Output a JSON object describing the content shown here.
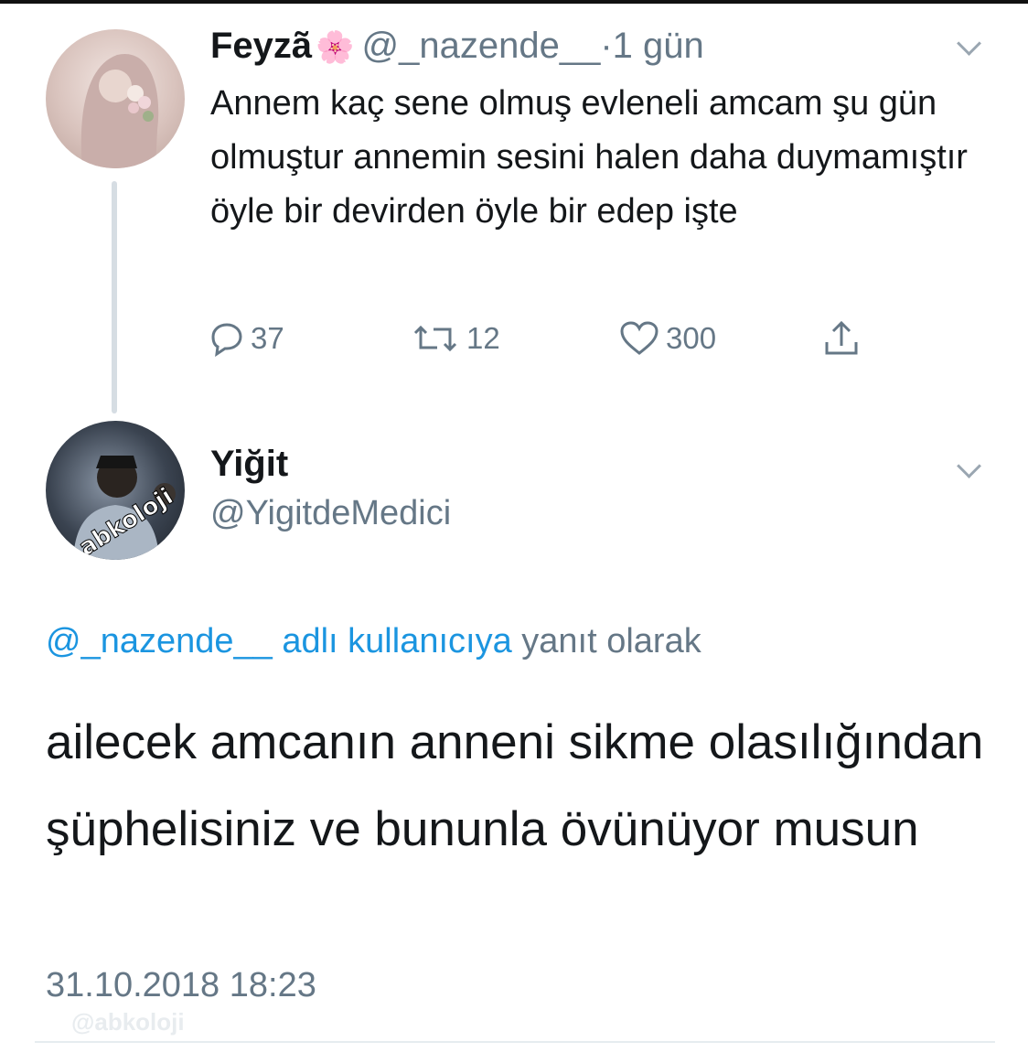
{
  "tweet": {
    "author_name": "Feyzã",
    "author_emoji": "🌸",
    "handle": "@_nazende__",
    "separator": "·",
    "time": "1 gün",
    "text": "Annem kaç sene olmuş evleneli amcam şu gün olmuştur annemin sesini halen daha duymamıştır öyle bir devirden öyle bir edep işte",
    "actions": {
      "reply_icon": "reply-icon",
      "reply_count": "37",
      "retweet_icon": "retweet-icon",
      "retweet_count": "12",
      "like_icon": "heart-icon",
      "like_count": "300",
      "share_icon": "share-icon"
    }
  },
  "reply": {
    "author_name": "Yiğit",
    "handle": "@YigitdeMedici",
    "avatar_overlay_text": "abkoloji",
    "replying_to_handle": "@_nazende__",
    "replying_to_middle": "adlı kullanıcıya",
    "replying_to_suffix": "yanıt olarak",
    "text": "ailecek amcanın anneni sikme olasılığından şüphelisiniz ve bununla övünüyor musun",
    "timestamp": "31.10.2018 18:23"
  },
  "watermark": "@abkoloji"
}
